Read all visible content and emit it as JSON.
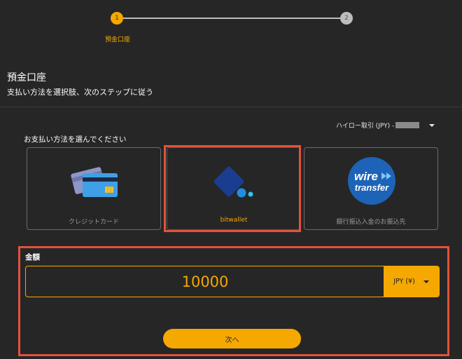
{
  "stepper": {
    "steps": [
      {
        "number": "1",
        "label": "預金口座"
      },
      {
        "number": "2"
      }
    ]
  },
  "header": {
    "title": "預金口座",
    "subtitle": "支払い方法を選択肢、次のステップに従う"
  },
  "account_selector": {
    "value": "ハイロー取引 (JPY) -"
  },
  "payment": {
    "label": "お支払い方法を選んでください",
    "methods": [
      {
        "label": "クレジットカード",
        "icon": "credit-card-icon"
      },
      {
        "label": "bitwallet",
        "icon": "bitwallet-logo",
        "selected": true
      },
      {
        "label": "銀行振込入金のお振込先",
        "icon": "wire-transfer-logo",
        "logo_text_1": "wire",
        "logo_text_2": "transfer"
      }
    ]
  },
  "amount": {
    "label": "金額",
    "value": "10000",
    "currency": "JPY (¥)"
  },
  "next_button": "次へ",
  "colors": {
    "background": "#262626",
    "accent": "#f5a800",
    "highlight": "#e2523d"
  }
}
